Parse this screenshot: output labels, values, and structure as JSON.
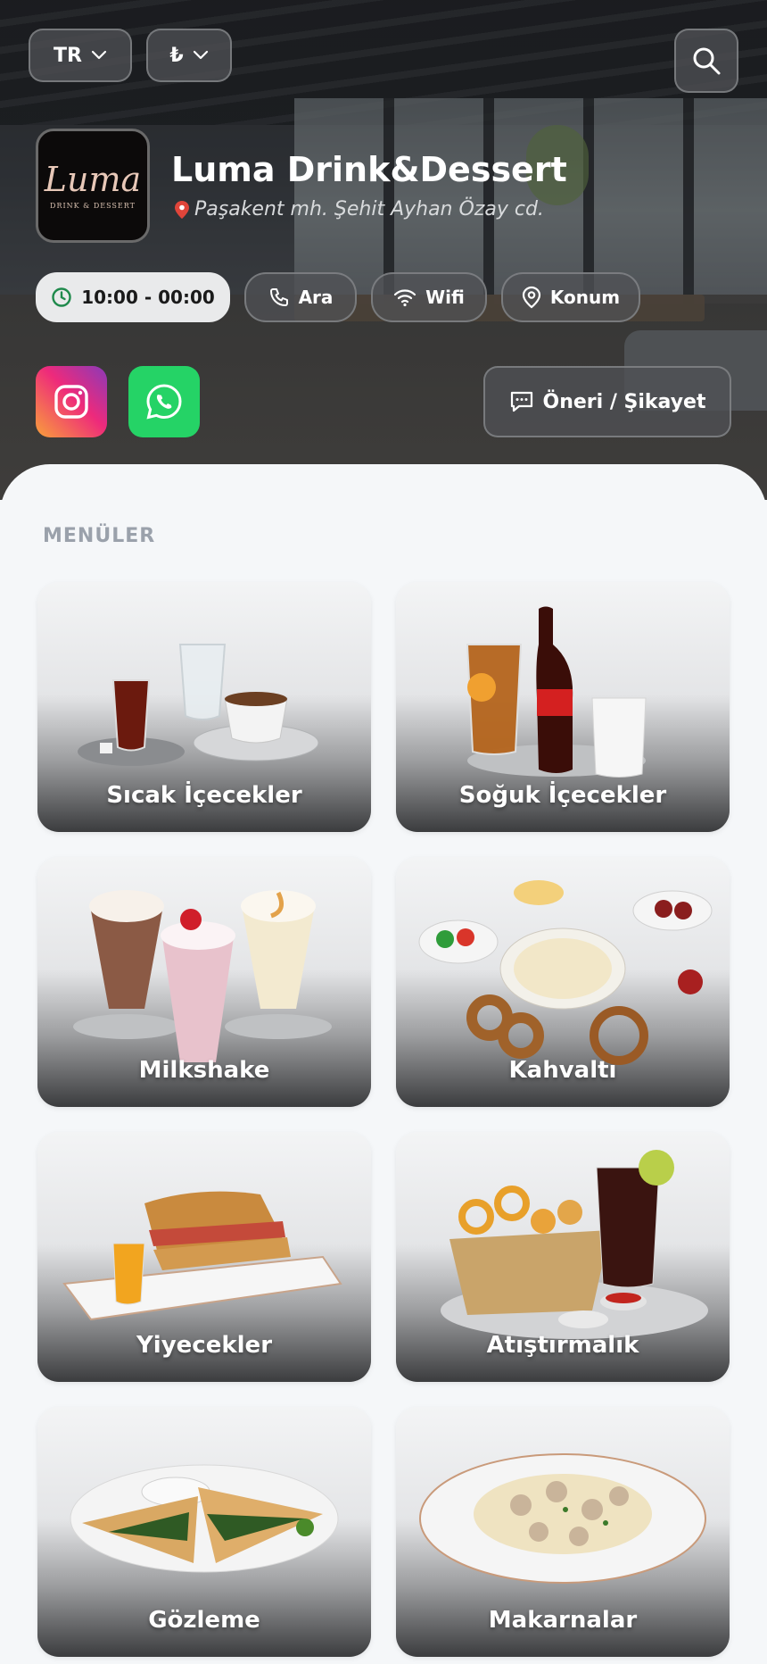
{
  "header": {
    "language": "TR",
    "currency": "₺",
    "search_icon": "search-icon"
  },
  "business": {
    "logo_text": "Luma",
    "logo_subtext": "DRINK & DESSERT",
    "name": "Luma Drink&Dessert",
    "address": "Paşakent mh. Şehit Ayhan Özay cd."
  },
  "actions": {
    "hours": "10:00 - 00:00",
    "call": "Ara",
    "wifi": "Wifi",
    "location": "Konum",
    "feedback": "Öneri / Şikayet"
  },
  "colors": {
    "accent_green": "#25d366",
    "hours_icon": "#1f8a4c",
    "section_title": "#9aa1ab"
  },
  "menus": {
    "title": "MENÜLER",
    "items": [
      {
        "label": "Sıcak İçecekler"
      },
      {
        "label": "Soğuk İçecekler"
      },
      {
        "label": "Milkshake"
      },
      {
        "label": "Kahvaltı"
      },
      {
        "label": "Yiyecekler"
      },
      {
        "label": "Atıştırmalık"
      },
      {
        "label": "Gözleme"
      },
      {
        "label": "Makarnalar"
      }
    ]
  }
}
